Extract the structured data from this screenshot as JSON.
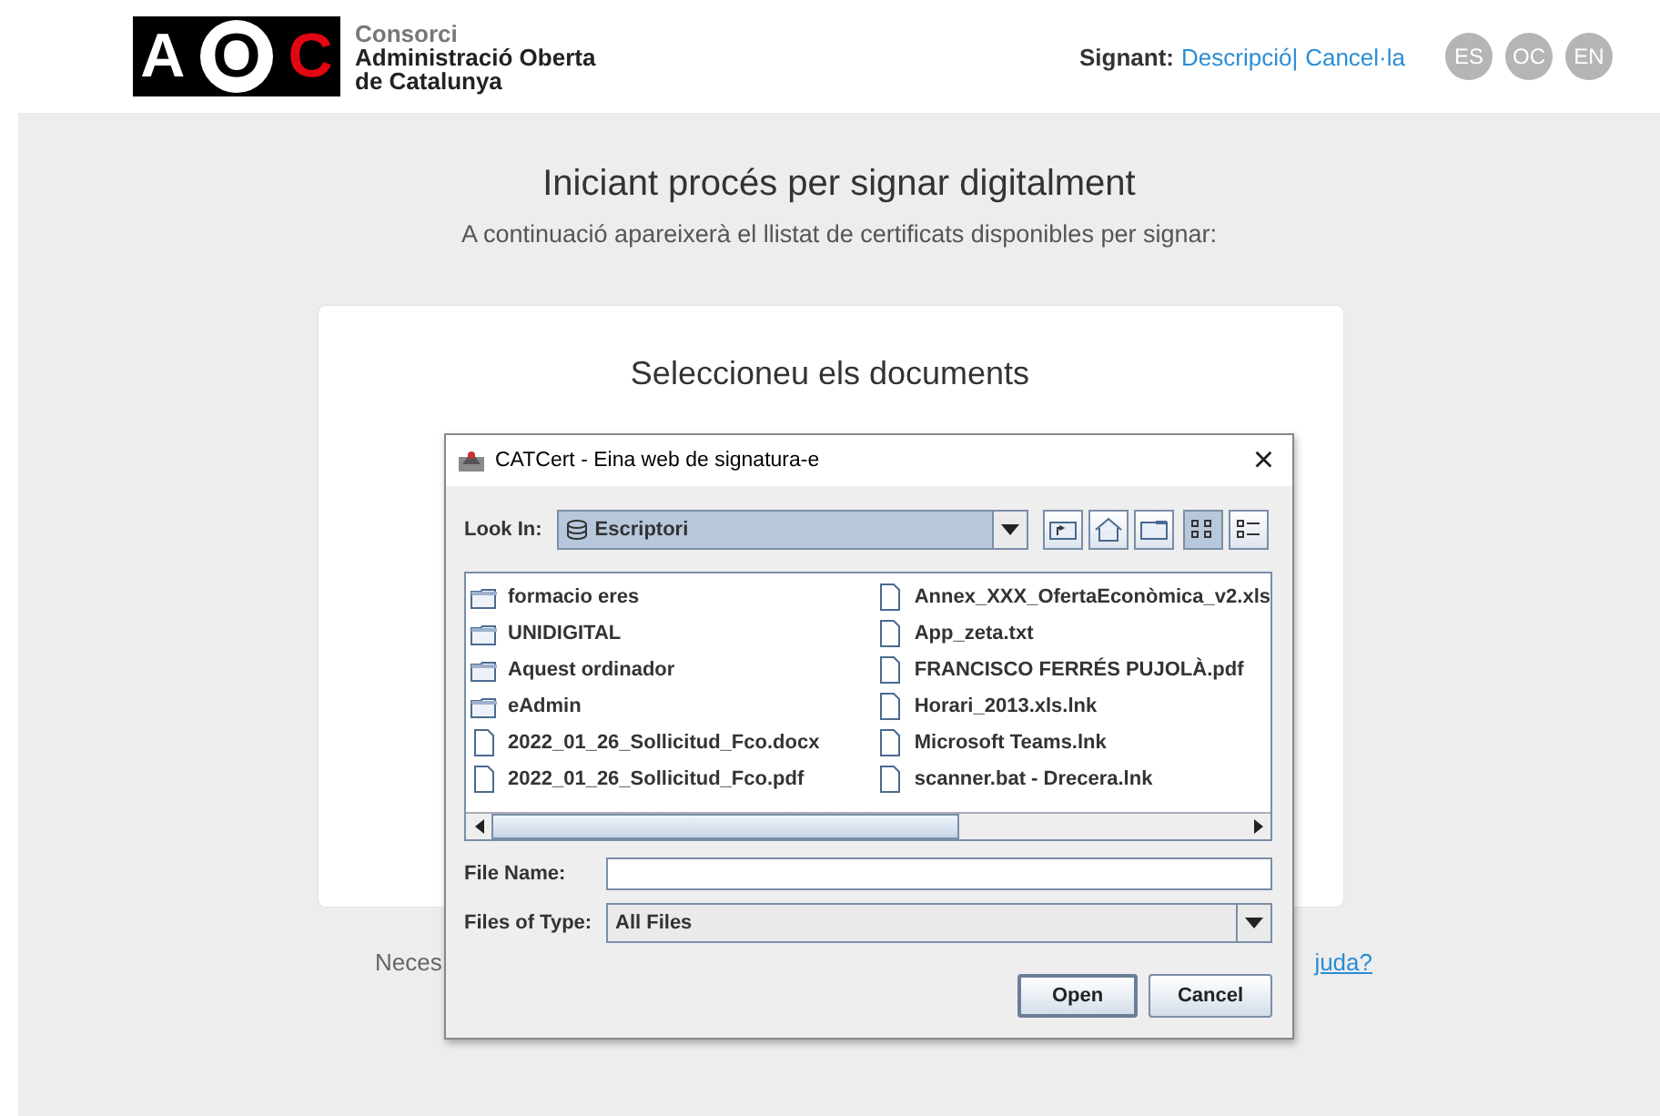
{
  "header": {
    "logo_letters": [
      "A",
      "O",
      "C"
    ],
    "org_lines": [
      "Consorci",
      "Administració Oberta",
      "de Catalunya"
    ],
    "signer_label": "Signant:",
    "links": [
      "Descripció",
      "Cancel·la"
    ],
    "separator": "|",
    "languages": [
      "ES",
      "OC",
      "EN"
    ]
  },
  "page": {
    "title": "Iniciant procés per signar digitalment",
    "subtitle": "A continuació apareixerà el llistat de certificats disponibles per signar:",
    "card_title": "Seleccioneu els documents",
    "help_text": "Neces",
    "help_link": "juda?"
  },
  "dialog": {
    "title": "CATCert - Eina web de signatura-e",
    "close": "×",
    "look_in_label": "Look In:",
    "look_in_value": "Escriptori",
    "files": [
      {
        "name": "formacio eres",
        "kind": "folder"
      },
      {
        "name": "UNIDIGITAL",
        "kind": "folder"
      },
      {
        "name": "Aquest ordinador",
        "kind": "folder"
      },
      {
        "name": "eAdmin",
        "kind": "folder"
      },
      {
        "name": "2022_01_26_Sollicitud_Fco.docx",
        "kind": "file"
      },
      {
        "name": "2022_01_26_Sollicitud_Fco.pdf",
        "kind": "file"
      },
      {
        "name": "Annex_XXX_OfertaEconòmica_v2.xls",
        "kind": "file"
      },
      {
        "name": "App_zeta.txt",
        "kind": "file"
      },
      {
        "name": "FRANCISCO FERRÉS PUJOLÀ.pdf",
        "kind": "file"
      },
      {
        "name": "Horari_2013.xls.lnk",
        "kind": "file"
      },
      {
        "name": "Microsoft Teams.lnk",
        "kind": "file"
      },
      {
        "name": "scanner.bat - Drecera.lnk",
        "kind": "file"
      }
    ],
    "file_name_label": "File Name:",
    "file_type_label": "Files of Type:",
    "file_type_value": "All Files",
    "buttons": [
      "Open",
      "Cancel"
    ]
  }
}
